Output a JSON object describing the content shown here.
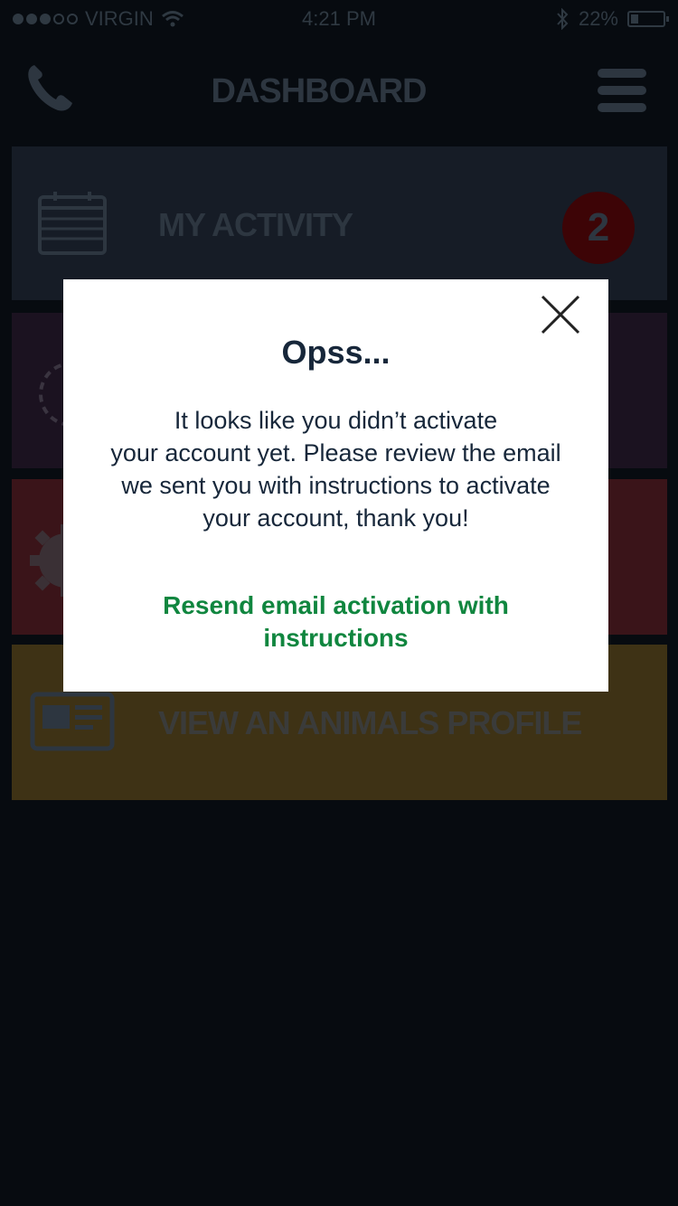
{
  "status_bar": {
    "carrier": "VIRGIN",
    "time": "4:21 PM",
    "battery": "22%",
    "battery_level": 0.22
  },
  "header": {
    "title": "DASHBOARD",
    "left_icon": "phone-icon",
    "right_icon": "hamburger-menu-icon"
  },
  "tiles": [
    {
      "label": "MY ACTIVITY",
      "icon": "calendar-icon",
      "badge": "2",
      "color": "#161c26"
    },
    {
      "label": "",
      "icon": "dashed-circle-icon",
      "color": "#1b1220"
    },
    {
      "label": "",
      "icon": "gear-icon",
      "color": "#3a1419"
    },
    {
      "label": "VIEW AN ANIMALS PROFILE",
      "icon": "profile-card-icon",
      "color": "#3e3215"
    }
  ],
  "dialog": {
    "title": "Opss...",
    "message_lines": [
      "It looks like you didn’t activate",
      "your account yet. Please review the email",
      "we sent you with instructions to activate",
      "your account, thank you!"
    ],
    "link_lines": [
      "Resend email activation with",
      "instructions"
    ],
    "close_icon": "close-icon",
    "link_color": "#10863f"
  }
}
